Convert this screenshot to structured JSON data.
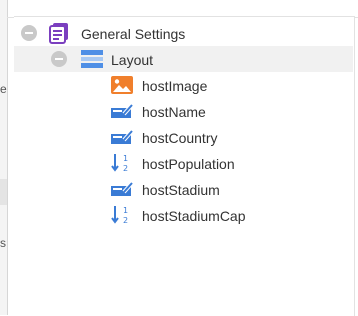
{
  "left_panel": {
    "fragments": [
      "e",
      "s"
    ]
  },
  "tree": {
    "root": {
      "label": "General Settings",
      "icon": "form-icon",
      "expanded": true,
      "children": [
        {
          "label": "Layout",
          "icon": "layout-icon",
          "expanded": true,
          "children": [
            {
              "label": "hostImage",
              "icon": "image-icon"
            },
            {
              "label": "hostName",
              "icon": "text-field-icon"
            },
            {
              "label": "hostCountry",
              "icon": "text-field-icon"
            },
            {
              "label": "hostPopulation",
              "icon": "number-field-icon"
            },
            {
              "label": "hostStadium",
              "icon": "text-field-icon"
            },
            {
              "label": "hostStadiumCap",
              "icon": "number-field-icon"
            }
          ]
        }
      ]
    }
  },
  "colors": {
    "form_icon": "#7b3fbf",
    "layout_icon": "#4f8fe6",
    "image_icon": "#f07f2c",
    "field_icon": "#3a7bd5",
    "toggle": "#c9c9c9",
    "selected_row": "#f1f1f1"
  }
}
